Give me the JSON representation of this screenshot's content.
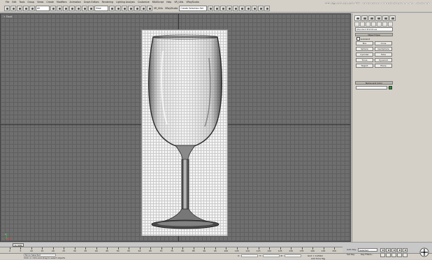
{
  "menubar": {
    "items": [
      "File",
      "Edit",
      "Tools",
      "Group",
      "Views",
      "Create",
      "Modifiers",
      "Animation",
      "Graph Editors",
      "Rendering",
      "Lighting Analysis",
      "Customize",
      "MAXScript",
      "Help",
      "VR_Utils",
      "VRayStudio"
    ],
    "watermark": "思缘设计论坛 WWW.MISSYUAN.COM"
  },
  "toolbar": {
    "filter_value": "All",
    "refcoord_value": "View",
    "named_selection_placeholder": "Create Selection Set"
  },
  "viewport": {
    "label": "+ Front"
  },
  "command_panel": {
    "category_dropdown": "Standard Primitives",
    "object_type_title": "Object Type",
    "autogrid_label": "AutoGrid",
    "primitives": [
      "Box",
      "Cone",
      "Sphere",
      "GeoSphere",
      "Cylinder",
      "Tube",
      "Torus",
      "Pyramid",
      "Teapot",
      "Plane"
    ],
    "name_color_title": "Name and Color",
    "name_value": "",
    "object_color": "#1f9a2e"
  },
  "timeline": {
    "frame_indicator": "0 / 100",
    "ticks": [
      "0",
      "5",
      "10",
      "15",
      "20",
      "25",
      "30",
      "35",
      "40",
      "45",
      "50",
      "55",
      "60",
      "65",
      "70",
      "75",
      "80",
      "85",
      "90",
      "95",
      "100",
      "105",
      "110",
      "115",
      "120",
      "125",
      "130",
      "135",
      "140",
      "145",
      "150"
    ]
  },
  "status": {
    "selection": "None Selected",
    "prompt": "Click or click-and-drag to select objects",
    "x_label": "X:",
    "y_label": "Y:",
    "z_label": "Z:",
    "grid": "Grid = 0.254m",
    "add_time_tag": "Add Time Tag"
  },
  "animation": {
    "autokey_label": "Auto Key",
    "setkey_label": "Set Key",
    "selection_mode": "Selected",
    "keyfilters_label": "Key Filters..."
  }
}
